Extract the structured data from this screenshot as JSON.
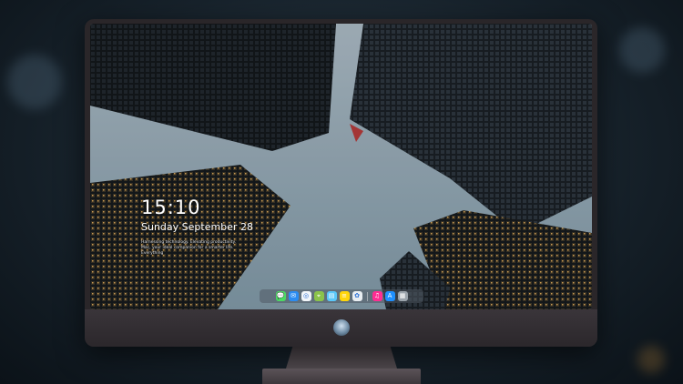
{
  "lock_screen": {
    "time": "15:10",
    "date": "Sunday September 28",
    "tagline": "Harnessing technology. Elevating productivity. Mac, your ideal companion for a smarter life. Everything"
  },
  "dock": {
    "items": [
      {
        "name": "messages",
        "glyph": "💬",
        "color": "#4cd964"
      },
      {
        "name": "mail",
        "glyph": "✉",
        "color": "#2b8cf2"
      },
      {
        "name": "safari",
        "glyph": "◎",
        "color": "#f2f6fa"
      },
      {
        "name": "maps",
        "glyph": "⌖",
        "color": "#8bc34a"
      },
      {
        "name": "finder",
        "glyph": "▤",
        "color": "#5ac8fa"
      },
      {
        "name": "notes",
        "glyph": "≡",
        "color": "#ffd60a"
      },
      {
        "name": "photos",
        "glyph": "✿",
        "color": "#e9eef2"
      },
      {
        "name": "music",
        "glyph": "♫",
        "color": "#ff2d92"
      },
      {
        "name": "app-store",
        "glyph": "A",
        "color": "#1e90ff"
      },
      {
        "name": "trash",
        "glyph": "▦",
        "color": "#9aa3ab"
      }
    ]
  }
}
